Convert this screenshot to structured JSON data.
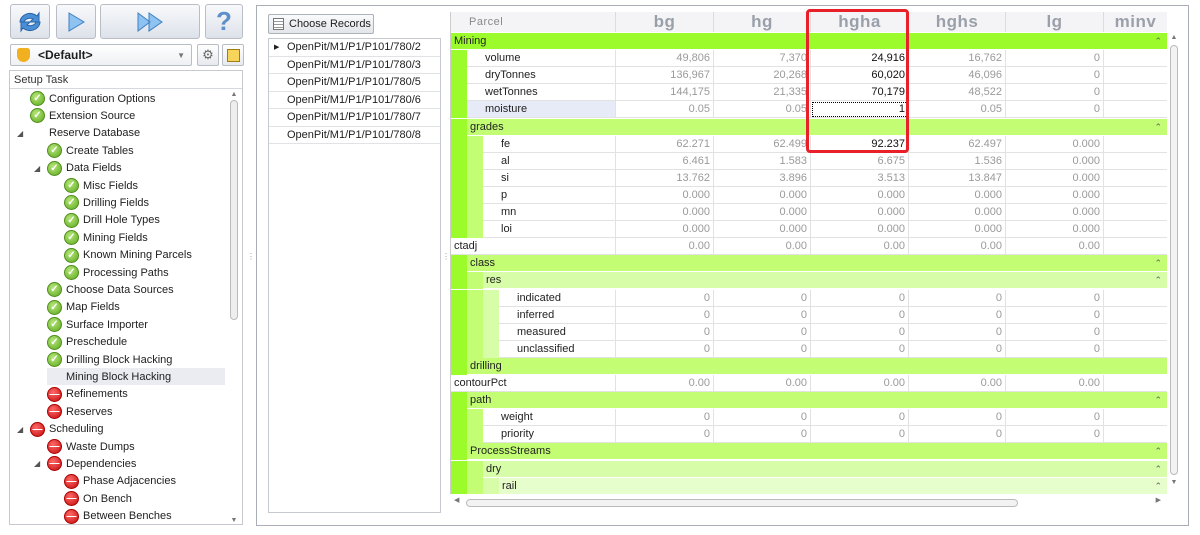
{
  "toolbar": {
    "refresh": "refresh-icon",
    "run": "play-icon",
    "run_all": "fast-forward-icon",
    "help": "?"
  },
  "profile": {
    "selected": "<Default>"
  },
  "tree": {
    "header": "Setup Task",
    "items": [
      {
        "label": "Configuration Options",
        "level": 0,
        "status": "ok"
      },
      {
        "label": "Extension Source",
        "level": 0,
        "status": "ok"
      },
      {
        "label": "Reserve Database",
        "level": 0,
        "status": "pending",
        "expanded": true
      },
      {
        "label": "Create Tables",
        "level": 1,
        "status": "ok"
      },
      {
        "label": "Data Fields",
        "level": 1,
        "status": "ok",
        "expanded": true
      },
      {
        "label": "Misc Fields",
        "level": 2,
        "status": "ok"
      },
      {
        "label": "Drilling Fields",
        "level": 2,
        "status": "ok"
      },
      {
        "label": "Drill Hole Types",
        "level": 2,
        "status": "ok"
      },
      {
        "label": "Mining Fields",
        "level": 2,
        "status": "ok"
      },
      {
        "label": "Known Mining Parcels",
        "level": 2,
        "status": "ok"
      },
      {
        "label": "Processing Paths",
        "level": 2,
        "status": "ok"
      },
      {
        "label": "Choose Data Sources",
        "level": 1,
        "status": "ok"
      },
      {
        "label": "Map Fields",
        "level": 1,
        "status": "ok"
      },
      {
        "label": "Surface Importer",
        "level": 1,
        "status": "ok"
      },
      {
        "label": "Preschedule",
        "level": 1,
        "status": "ok"
      },
      {
        "label": "Drilling Block Hacking",
        "level": 1,
        "status": "ok"
      },
      {
        "label": "Mining Block Hacking",
        "level": 1,
        "status": "pending",
        "selected": true
      },
      {
        "label": "Refinements",
        "level": 1,
        "status": "err"
      },
      {
        "label": "Reserves",
        "level": 1,
        "status": "err"
      },
      {
        "label": "Scheduling",
        "level": 0,
        "status": "err",
        "expanded": true
      },
      {
        "label": "Waste Dumps",
        "level": 1,
        "status": "err"
      },
      {
        "label": "Dependencies",
        "level": 1,
        "status": "err",
        "expanded": true
      },
      {
        "label": "Phase Adjacencies",
        "level": 2,
        "status": "err"
      },
      {
        "label": "On Bench",
        "level": 2,
        "status": "err"
      },
      {
        "label": "Between Benches",
        "level": 2,
        "status": "err"
      }
    ]
  },
  "records": {
    "button": "Choose Records",
    "items": [
      "OpenPit/M1/P1/P101/780/2",
      "OpenPit/M1/P1/P101/780/3",
      "OpenPit/M1/P1/P101/780/5",
      "OpenPit/M1/P1/P101/780/6",
      "OpenPit/M1/P1/P101/780/7",
      "OpenPit/M1/P1/P101/780/8"
    ]
  },
  "grid": {
    "header_label": "Parcel",
    "columns": [
      "bg",
      "hg",
      "hgha",
      "hghs",
      "lg",
      "minv"
    ],
    "highlight_column": "hgha",
    "rows": [
      {
        "t": "g",
        "d": 0,
        "label": "Mining"
      },
      {
        "t": "v",
        "d": 1,
        "label": "volume",
        "values": [
          "49,806",
          "7,370",
          "24,916",
          "16,762",
          "0"
        ]
      },
      {
        "t": "v",
        "d": 1,
        "label": "dryTonnes",
        "values": [
          "136,967",
          "20,268",
          "60,020",
          "46,096",
          "0"
        ]
      },
      {
        "t": "v",
        "d": 1,
        "label": "wetTonnes",
        "values": [
          "144,175",
          "21,335",
          "70,179",
          "48,522",
          "0"
        ]
      },
      {
        "t": "v",
        "d": 1,
        "label": "moisture",
        "values": [
          "0.05",
          "0.05",
          "1",
          "0.05",
          "0"
        ],
        "focused": true
      },
      {
        "t": "g",
        "d": 1,
        "label": "grades"
      },
      {
        "t": "v",
        "d": 2,
        "label": "fe",
        "values": [
          "62.271",
          "62.499",
          "92.237",
          "62.497",
          "0.000"
        ]
      },
      {
        "t": "v",
        "d": 2,
        "label": "al",
        "values": [
          "6.461",
          "1.583",
          "6.675",
          "1.536",
          "0.000"
        ]
      },
      {
        "t": "v",
        "d": 2,
        "label": "si",
        "values": [
          "13.762",
          "3.896",
          "3.513",
          "13.847",
          "0.000"
        ]
      },
      {
        "t": "v",
        "d": 2,
        "label": "p",
        "values": [
          "0.000",
          "0.000",
          "0.000",
          "0.000",
          "0.000"
        ]
      },
      {
        "t": "v",
        "d": 2,
        "label": "mn",
        "values": [
          "0.000",
          "0.000",
          "0.000",
          "0.000",
          "0.000"
        ]
      },
      {
        "t": "v",
        "d": 2,
        "label": "loi",
        "values": [
          "0.000",
          "0.000",
          "0.000",
          "0.000",
          "0.000"
        ]
      },
      {
        "t": "v",
        "d": 1,
        "label": "ctadj",
        "flat": true,
        "values": [
          "0.00",
          "0.00",
          "0.00",
          "0.00",
          "0.00"
        ]
      },
      {
        "t": "g",
        "d": 1,
        "label": "class"
      },
      {
        "t": "g",
        "d": 2,
        "label": "res"
      },
      {
        "t": "v",
        "d": 3,
        "label": "indicated",
        "values": [
          "0",
          "0",
          "0",
          "0",
          "0"
        ]
      },
      {
        "t": "v",
        "d": 3,
        "label": "inferred",
        "values": [
          "0",
          "0",
          "0",
          "0",
          "0"
        ]
      },
      {
        "t": "v",
        "d": 3,
        "label": "measured",
        "values": [
          "0",
          "0",
          "0",
          "0",
          "0"
        ]
      },
      {
        "t": "v",
        "d": 3,
        "label": "unclassified",
        "values": [
          "0",
          "0",
          "0",
          "0",
          "0"
        ]
      },
      {
        "t": "g",
        "d": 1,
        "label": "drilling",
        "nocaret": true
      },
      {
        "t": "v",
        "d": 1,
        "label": "contourPct",
        "flat": true,
        "values": [
          "0.00",
          "0.00",
          "0.00",
          "0.00",
          "0.00"
        ]
      },
      {
        "t": "g",
        "d": 1,
        "label": "path"
      },
      {
        "t": "v",
        "d": 2,
        "label": "weight",
        "values": [
          "0",
          "0",
          "0",
          "0",
          "0"
        ]
      },
      {
        "t": "v",
        "d": 2,
        "label": "priority",
        "values": [
          "0",
          "0",
          "0",
          "0",
          "0"
        ]
      },
      {
        "t": "g",
        "d": 1,
        "label": "ProcessStreams"
      },
      {
        "t": "g",
        "d": 2,
        "label": "dry"
      },
      {
        "t": "g",
        "d": 3,
        "label": "rail"
      }
    ],
    "level_colors": [
      "#9cfb2a",
      "#c2fd74",
      "#d7fda8",
      "#e6fdcc"
    ],
    "highlight_color": "#e8202a"
  }
}
